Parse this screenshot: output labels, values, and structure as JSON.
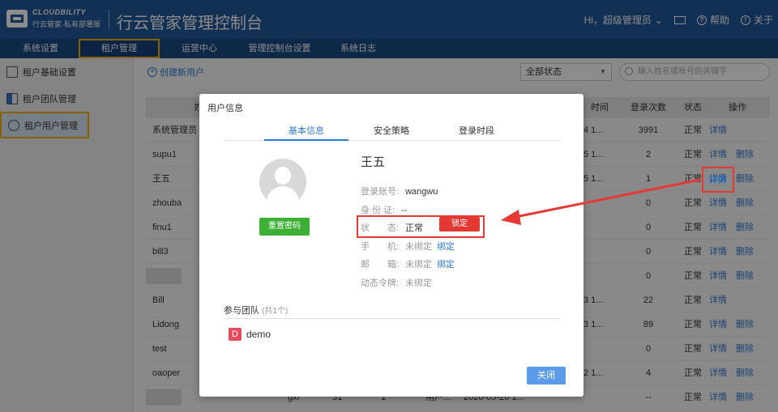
{
  "header": {
    "logo_line1": "CLOUDBILITY",
    "logo_line2": "行云管家·私有部署版",
    "title": "行云管家管理控制台",
    "user": "Hi，超级管理员",
    "user_chevron": "⌄",
    "help": "帮助",
    "about": "关于"
  },
  "nav": {
    "items": [
      "系统设置",
      "租户管理",
      "运营中心",
      "管理控制台设置",
      "系统日志"
    ]
  },
  "sidebar": {
    "items": [
      "租户基础设置",
      "租户团队管理",
      "租户用户管理"
    ]
  },
  "toolbar": {
    "create": "创建新用户",
    "status_select": "全部状态",
    "search_placeholder": "输入姓名或账号的关键字"
  },
  "table": {
    "headers": [
      "姓",
      "时间",
      "登录次数",
      "状态",
      "操作"
    ],
    "rows": [
      {
        "name": "系统管理员",
        "time": "4 1...",
        "count": "3991",
        "status": "正常",
        "detail": "详情",
        "delete": ""
      },
      {
        "name": "supu1",
        "time": "5 1...",
        "count": "2",
        "status": "正常",
        "detail": "详情",
        "delete": "删除"
      },
      {
        "name": "王五",
        "time": "5 1...",
        "count": "1",
        "status": "正常",
        "detail": "详情",
        "delete": "删除"
      },
      {
        "name": "zhouba",
        "time": "",
        "count": "0",
        "status": "正常",
        "detail": "详情",
        "delete": "删除"
      },
      {
        "name": "finu1",
        "time": "",
        "count": "0",
        "status": "正常",
        "detail": "详情",
        "delete": "删除"
      },
      {
        "name": "bill3",
        "time": "",
        "count": "0",
        "status": "正常",
        "detail": "详情",
        "delete": "删除"
      },
      {
        "name": "",
        "time": "",
        "count": "0",
        "status": "正常",
        "detail": "详情",
        "delete": "删除"
      },
      {
        "name": "Bill",
        "time": "3 1...",
        "count": "22",
        "status": "正常",
        "detail": "详情",
        "delete": ""
      },
      {
        "name": "Lidong",
        "time": "3 1...",
        "count": "89",
        "status": "正常",
        "detail": "详情",
        "delete": "删除"
      },
      {
        "name": "test",
        "time": "",
        "count": "0",
        "status": "正常",
        "detail": "详情",
        "delete": "删除"
      },
      {
        "name": "oaoper",
        "time": "2 1...",
        "count": "4",
        "status": "正常",
        "detail": "详情",
        "delete": "删除"
      },
      {
        "name": "",
        "col2": "gxf",
        "col3": "31",
        "col4": "1",
        "col5": "用户...",
        "time": "2020-05-20 1...",
        "count": "--",
        "status": "正常",
        "detail": "详情",
        "delete": "删除"
      }
    ]
  },
  "modal": {
    "title": "用户信息",
    "tabs": [
      "基本信息",
      "安全策略",
      "登录时段"
    ],
    "user_name": "王五",
    "reset_password": "重置密码",
    "fields": {
      "account_label": "登录账号:",
      "account_value": "wangwu",
      "id_label": "身 份 证:",
      "id_value": "--",
      "status_label": "状　　态:",
      "status_value": "正常",
      "lock": "锁定",
      "phone_label": "手　　机:",
      "phone_value": "未绑定",
      "phone_bind": "绑定",
      "email_label": "邮　　箱:",
      "email_value": "未绑定",
      "email_bind": "绑定",
      "token_label": "动态令牌:",
      "token_value": "未绑定"
    },
    "team_title": "参与团队",
    "team_count": "(共1个)",
    "team_badge": "D",
    "team_name": "demo",
    "close": "关闭"
  },
  "colors": {
    "header_bg": "#21579a",
    "nav_bg": "#1b4a82",
    "highlight": "#f4b400",
    "annotation_red": "#e53935",
    "link_blue": "#2f7ad3",
    "green": "#3cb034"
  }
}
